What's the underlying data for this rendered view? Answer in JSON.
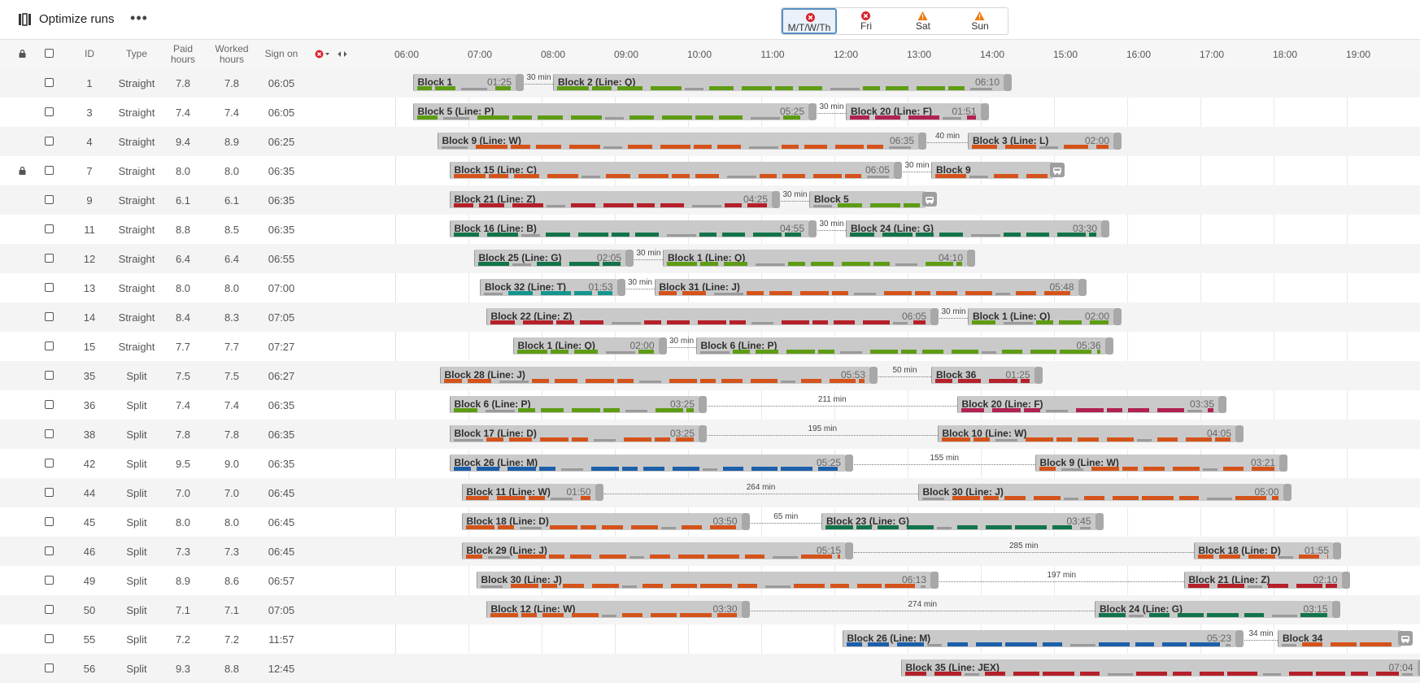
{
  "app": {
    "title": "Optimize runs",
    "more_label": "•••"
  },
  "day_tabs": [
    {
      "label": "M/T/W/Th",
      "status": "error",
      "active": true
    },
    {
      "label": "Fri",
      "status": "error",
      "active": false
    },
    {
      "label": "Sat",
      "status": "warning",
      "active": false
    },
    {
      "label": "Sun",
      "status": "warning",
      "active": false
    }
  ],
  "colors": {
    "green": "#5e9c13",
    "orange": "#d5531a",
    "crimson": "#b5202a",
    "magenta": "#b02252",
    "darkgreen": "#127449",
    "blue": "#1c5faa",
    "teal": "#13968e",
    "grey": "#9a9a9a",
    "error": "#d9232e",
    "warning": "#ee7a12"
  },
  "columns": {
    "id": "ID",
    "type": "Type",
    "paid": "Paid hours",
    "worked": "Worked hours",
    "sign_on": "Sign on"
  },
  "time_axis": [
    "06:00",
    "07:00",
    "08:00",
    "09:00",
    "10:00",
    "11:00",
    "12:00",
    "13:00",
    "14:00",
    "15:00",
    "16:00",
    "17:00",
    "18:00",
    "19:00"
  ],
  "runs": [
    {
      "id": "1",
      "type": "Straight",
      "paid": "7.8",
      "worked": "7.8",
      "sign_on": "06:05",
      "locked": false,
      "blocks": [
        {
          "name": "Block 1",
          "dur": "01:25",
          "start": "06:05",
          "end": "07:30",
          "color": "green"
        },
        {
          "name": "Block 2 (Line: Q)",
          "dur": "06:10",
          "start": "08:00",
          "end": "14:10",
          "color": "green"
        }
      ],
      "gaps": [
        {
          "label": "30 min",
          "after": 0
        }
      ]
    },
    {
      "id": "3",
      "type": "Straight",
      "paid": "7.4",
      "worked": "7.4",
      "sign_on": "06:05",
      "locked": false,
      "blocks": [
        {
          "name": "Block 5 (Line: P)",
          "dur": "05:25",
          "start": "06:05",
          "end": "11:30",
          "color": "green"
        },
        {
          "name": "Block 20 (Line: F)",
          "dur": "01:51",
          "start": "12:00",
          "end": "13:51",
          "color": "magenta"
        }
      ],
      "gaps": [
        {
          "label": "30 min",
          "after": 0
        }
      ]
    },
    {
      "id": "4",
      "type": "Straight",
      "paid": "9.4",
      "worked": "8.9",
      "sign_on": "06:25",
      "locked": false,
      "blocks": [
        {
          "name": "Block 9 (Line: W)",
          "dur": "06:35",
          "start": "06:25",
          "end": "13:00",
          "color": "orange"
        },
        {
          "name": "Block 3 (Line: L)",
          "dur": "02:00",
          "start": "13:40",
          "end": "15:40",
          "color": "orange"
        }
      ],
      "gaps": [
        {
          "label": "40 min",
          "after": 0
        }
      ]
    },
    {
      "id": "7",
      "type": "Straight",
      "paid": "8.0",
      "worked": "8.0",
      "sign_on": "06:35",
      "locked": true,
      "blocks": [
        {
          "name": "Block 15 (Line: C)",
          "dur": "06:05",
          "start": "06:35",
          "end": "12:40",
          "color": "orange"
        },
        {
          "name": "Block 9",
          "dur": "",
          "start": "13:10",
          "end": "14:50",
          "color": "orange"
        }
      ],
      "gaps": [
        {
          "label": "30 min",
          "after": 0
        }
      ]
    },
    {
      "id": "9",
      "type": "Straight",
      "paid": "6.1",
      "worked": "6.1",
      "sign_on": "06:35",
      "locked": false,
      "blocks": [
        {
          "name": "Block 21 (Line: Z)",
          "dur": "04:25",
          "start": "06:35",
          "end": "11:00",
          "color": "crimson"
        },
        {
          "name": "Block 5",
          "dur": "",
          "start": "11:30",
          "end": "13:05",
          "color": "green"
        }
      ],
      "gaps": [
        {
          "label": "30 min",
          "after": 0
        }
      ]
    },
    {
      "id": "11",
      "type": "Straight",
      "paid": "8.8",
      "worked": "8.5",
      "sign_on": "06:35",
      "locked": false,
      "blocks": [
        {
          "name": "Block 16 (Line: B)",
          "dur": "04:55",
          "start": "06:35",
          "end": "11:30",
          "color": "darkgreen"
        },
        {
          "name": "Block 24 (Line: G)",
          "dur": "03:30",
          "start": "12:00",
          "end": "15:30",
          "color": "darkgreen"
        }
      ],
      "gaps": [
        {
          "label": "30 min",
          "after": 0
        }
      ]
    },
    {
      "id": "12",
      "type": "Straight",
      "paid": "6.4",
      "worked": "6.4",
      "sign_on": "06:55",
      "locked": false,
      "blocks": [
        {
          "name": "Block 25 (Line: G)",
          "dur": "02:05",
          "start": "06:55",
          "end": "09:00",
          "color": "darkgreen"
        },
        {
          "name": "Block 1 (Line: Q)",
          "dur": "04:10",
          "start": "09:30",
          "end": "13:40",
          "color": "green"
        }
      ],
      "gaps": [
        {
          "label": "30 min",
          "after": 0
        }
      ]
    },
    {
      "id": "13",
      "type": "Straight",
      "paid": "8.0",
      "worked": "8.0",
      "sign_on": "07:00",
      "locked": false,
      "blocks": [
        {
          "name": "Block 32 (Line: T)",
          "dur": "01:53",
          "start": "07:00",
          "end": "08:53",
          "color": "teal"
        },
        {
          "name": "Block 31 (Line: J)",
          "dur": "05:48",
          "start": "09:23",
          "end": "15:11",
          "color": "orange"
        }
      ],
      "gaps": [
        {
          "label": "30 min",
          "after": 0
        }
      ]
    },
    {
      "id": "14",
      "type": "Straight",
      "paid": "8.4",
      "worked": "8.3",
      "sign_on": "07:05",
      "locked": false,
      "blocks": [
        {
          "name": "Block 22 (Line: Z)",
          "dur": "06:05",
          "start": "07:05",
          "end": "13:10",
          "color": "crimson"
        },
        {
          "name": "Block 1 (Line: Q)",
          "dur": "02:00",
          "start": "13:40",
          "end": "15:40",
          "color": "green"
        }
      ],
      "gaps": [
        {
          "label": "30 min",
          "after": 0
        }
      ]
    },
    {
      "id": "15",
      "type": "Straight",
      "paid": "7.7",
      "worked": "7.7",
      "sign_on": "07:27",
      "locked": false,
      "blocks": [
        {
          "name": "Block 1 (Line: Q)",
          "dur": "02:00",
          "start": "07:27",
          "end": "09:27",
          "color": "green"
        },
        {
          "name": "Block 6 (Line: P)",
          "dur": "05:36",
          "start": "09:57",
          "end": "15:33",
          "color": "green"
        }
      ],
      "gaps": [
        {
          "label": "30 min",
          "after": 0
        }
      ]
    },
    {
      "id": "35",
      "type": "Split",
      "paid": "7.5",
      "worked": "7.5",
      "sign_on": "06:27",
      "locked": false,
      "blocks": [
        {
          "name": "Block 28 (Line: J)",
          "dur": "05:53",
          "start": "06:27",
          "end": "12:20",
          "color": "orange"
        },
        {
          "name": "Block 36",
          "dur": "01:25",
          "start": "13:10",
          "end": "14:35",
          "color": "crimson"
        }
      ],
      "gaps": [
        {
          "label": "50 min",
          "after": 0
        }
      ]
    },
    {
      "id": "36",
      "type": "Split",
      "paid": "7.4",
      "worked": "7.4",
      "sign_on": "06:35",
      "locked": false,
      "blocks": [
        {
          "name": "Block 6 (Line: P)",
          "dur": "03:25",
          "start": "06:35",
          "end": "10:00",
          "color": "green"
        },
        {
          "name": "Block 20 (Line: F)",
          "dur": "03:35",
          "start": "13:31",
          "end": "17:06",
          "color": "magenta"
        }
      ],
      "gaps": [
        {
          "label": "211 min",
          "after": 0
        }
      ]
    },
    {
      "id": "38",
      "type": "Split",
      "paid": "7.8",
      "worked": "7.8",
      "sign_on": "06:35",
      "locked": false,
      "blocks": [
        {
          "name": "Block 17 (Line: D)",
          "dur": "03:25",
          "start": "06:35",
          "end": "10:00",
          "color": "orange"
        },
        {
          "name": "Block 10 (Line: W)",
          "dur": "04:05",
          "start": "13:15",
          "end": "17:20",
          "color": "orange"
        }
      ],
      "gaps": [
        {
          "label": "195 min",
          "after": 0
        }
      ]
    },
    {
      "id": "42",
      "type": "Split",
      "paid": "9.5",
      "worked": "9.0",
      "sign_on": "06:35",
      "locked": false,
      "blocks": [
        {
          "name": "Block 26 (Line: M)",
          "dur": "05:25",
          "start": "06:35",
          "end": "12:00",
          "color": "blue"
        },
        {
          "name": "Block 9 (Line: W)",
          "dur": "03:21",
          "start": "14:35",
          "end": "17:56",
          "color": "orange"
        }
      ],
      "gaps": [
        {
          "label": "155 min",
          "after": 0
        }
      ]
    },
    {
      "id": "44",
      "type": "Split",
      "paid": "7.0",
      "worked": "7.0",
      "sign_on": "06:45",
      "locked": false,
      "blocks": [
        {
          "name": "Block 11 (Line: W)",
          "dur": "01:50",
          "start": "06:45",
          "end": "08:35",
          "color": "orange"
        },
        {
          "name": "Block 30 (Line: J)",
          "dur": "05:00",
          "start": "12:59",
          "end": "17:59",
          "color": "orange"
        }
      ],
      "gaps": [
        {
          "label": "264 min",
          "after": 0
        }
      ]
    },
    {
      "id": "45",
      "type": "Split",
      "paid": "8.0",
      "worked": "8.0",
      "sign_on": "06:45",
      "locked": false,
      "blocks": [
        {
          "name": "Block 18 (Line: D)",
          "dur": "03:50",
          "start": "06:45",
          "end": "10:35",
          "color": "orange"
        },
        {
          "name": "Block 23 (Line: G)",
          "dur": "03:45",
          "start": "11:40",
          "end": "15:25",
          "color": "darkgreen"
        }
      ],
      "gaps": [
        {
          "label": "65 min",
          "after": 0
        }
      ]
    },
    {
      "id": "46",
      "type": "Split",
      "paid": "7.3",
      "worked": "7.3",
      "sign_on": "06:45",
      "locked": false,
      "blocks": [
        {
          "name": "Block 29 (Line: J)",
          "dur": "05:15",
          "start": "06:45",
          "end": "12:00",
          "color": "orange"
        },
        {
          "name": "Block 18 (Line: D)",
          "dur": "01:55",
          "start": "16:45",
          "end": "18:40",
          "color": "orange"
        }
      ],
      "gaps": [
        {
          "label": "285 min",
          "after": 0
        }
      ]
    },
    {
      "id": "49",
      "type": "Split",
      "paid": "8.9",
      "worked": "8.6",
      "sign_on": "06:57",
      "locked": false,
      "blocks": [
        {
          "name": "Block 30 (Line: J)",
          "dur": "06:13",
          "start": "06:57",
          "end": "13:10",
          "color": "orange"
        },
        {
          "name": "Block 21 (Line: Z)",
          "dur": "02:10",
          "start": "16:37",
          "end": "18:47",
          "color": "crimson"
        }
      ],
      "gaps": [
        {
          "label": "197 min",
          "after": 0
        }
      ]
    },
    {
      "id": "50",
      "type": "Split",
      "paid": "7.1",
      "worked": "7.1",
      "sign_on": "07:05",
      "locked": false,
      "blocks": [
        {
          "name": "Block 12 (Line: W)",
          "dur": "03:30",
          "start": "07:05",
          "end": "10:35",
          "color": "orange"
        },
        {
          "name": "Block 24 (Line: G)",
          "dur": "03:15",
          "start": "15:24",
          "end": "18:39",
          "color": "darkgreen"
        }
      ],
      "gaps": [
        {
          "label": "274 min",
          "after": 0
        }
      ]
    },
    {
      "id": "55",
      "type": "Split",
      "paid": "7.2",
      "worked": "7.2",
      "sign_on": "11:57",
      "locked": false,
      "blocks": [
        {
          "name": "Block 26 (Line: M)",
          "dur": "05:23",
          "start": "11:57",
          "end": "17:20",
          "color": "blue"
        },
        {
          "name": "Block 34",
          "dur": "",
          "start": "17:54",
          "end": "19:35",
          "color": "orange"
        }
      ],
      "gaps": [
        {
          "label": "34 min",
          "after": 0
        }
      ]
    },
    {
      "id": "56",
      "type": "Split",
      "paid": "9.3",
      "worked": "8.8",
      "sign_on": "12:45",
      "locked": false,
      "blocks": [
        {
          "name": "Block 35 (Line: JEX)",
          "dur": "07:04",
          "start": "12:45",
          "end": "19:49",
          "color": "crimson"
        }
      ],
      "gaps": []
    }
  ]
}
